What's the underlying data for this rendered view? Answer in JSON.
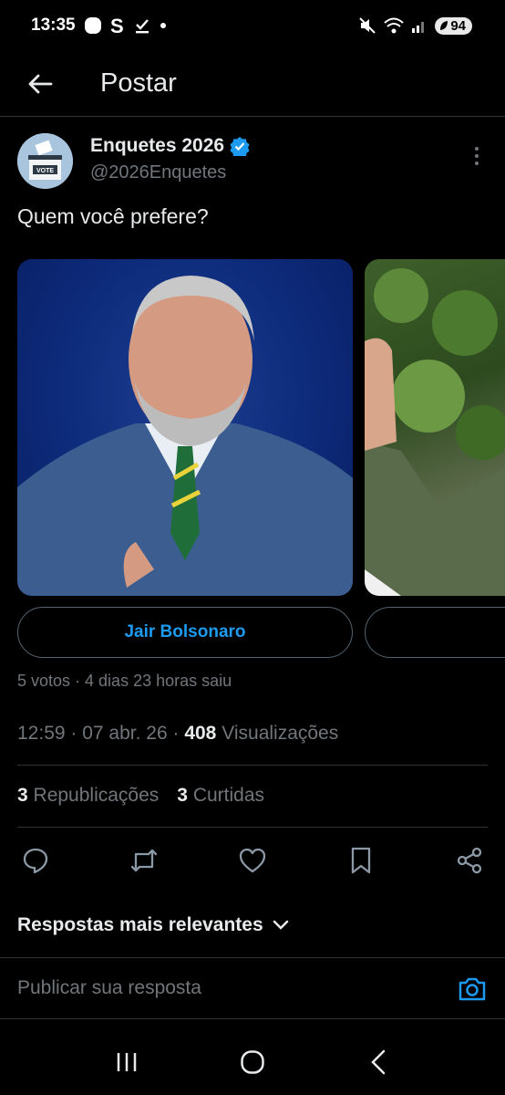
{
  "status_bar": {
    "time": "13:35",
    "battery": "94"
  },
  "header": {
    "title": "Postar"
  },
  "author": {
    "name": "Enquetes 2026",
    "handle": "@2026Enquetes",
    "avatar_text": "VOTE"
  },
  "post": {
    "text": "Quem você prefere?"
  },
  "poll": {
    "options": [
      {
        "label": "Jair Bolsonaro",
        "image": "portrait-man-in-suit"
      },
      {
        "label": "",
        "image": "portrait-man-green-jacket"
      }
    ],
    "info": "5 votos · 4 dias 23 horas saiu"
  },
  "meta": {
    "time": "12:59",
    "date": "07 abr. 26",
    "views_count": "408",
    "views_label": "Visualizações"
  },
  "stats": {
    "reposts_count": "3",
    "reposts_label": "Republicações",
    "likes_count": "3",
    "likes_label": "Curtidas"
  },
  "actions": [
    "reply-icon",
    "repost-icon",
    "like-icon",
    "bookmark-icon",
    "share-icon"
  ],
  "replies": {
    "sort_label": "Respostas mais relevantes",
    "placeholder": "Publicar sua resposta"
  },
  "colors": {
    "accent": "#1d9bf0",
    "background": "#000000",
    "muted": "#71767b"
  }
}
